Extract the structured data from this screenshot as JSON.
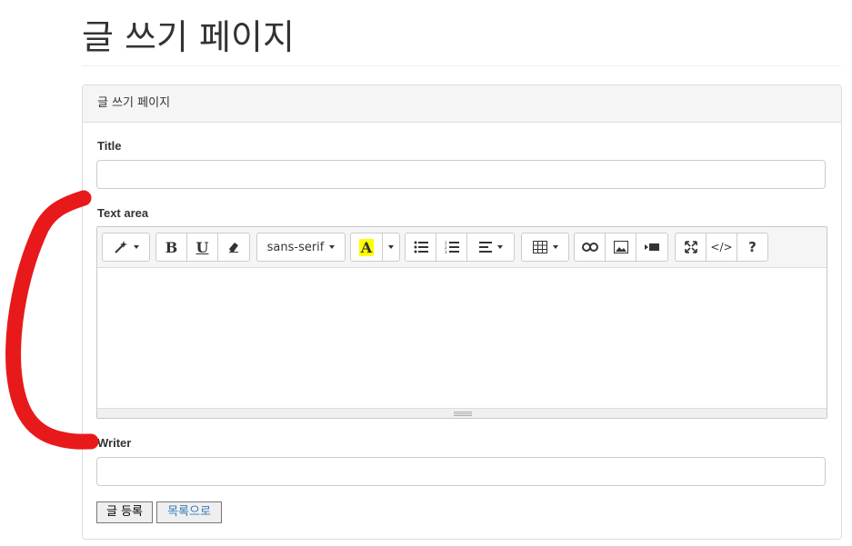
{
  "page": {
    "title": "글 쓰기 페이지"
  },
  "panel": {
    "heading": "글 쓰기 페이지",
    "title_label": "Title",
    "title_value": "",
    "textarea_label": "Text area",
    "writer_label": "Writer",
    "writer_value": ""
  },
  "toolbar": {
    "font_name": "sans-serif",
    "bold": "B",
    "underline": "U",
    "color_letter": "A",
    "code": "</>",
    "help": "?"
  },
  "actions": {
    "submit_label": "글 등록",
    "list_label": "목록으로"
  },
  "colors": {
    "annotation": "#e8191b",
    "link": "#337ab7",
    "highlight": "#ffff00"
  }
}
